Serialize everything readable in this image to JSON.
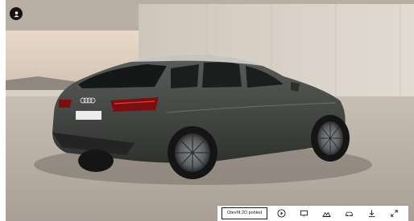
{
  "toolbar": {
    "view_2d_label": "Otevřít 2D pohled",
    "icons": [
      "play-icon",
      "screen-icon",
      "landscape-icon",
      "car-view-icon",
      "download-icon",
      "fullscreen-icon"
    ]
  },
  "vehicle": {
    "plate_text": ""
  },
  "colors": {
    "toolbar_bg": "#ffffff",
    "icon_color": "#1a1a1a",
    "car_paint": "#4a4d4a"
  }
}
